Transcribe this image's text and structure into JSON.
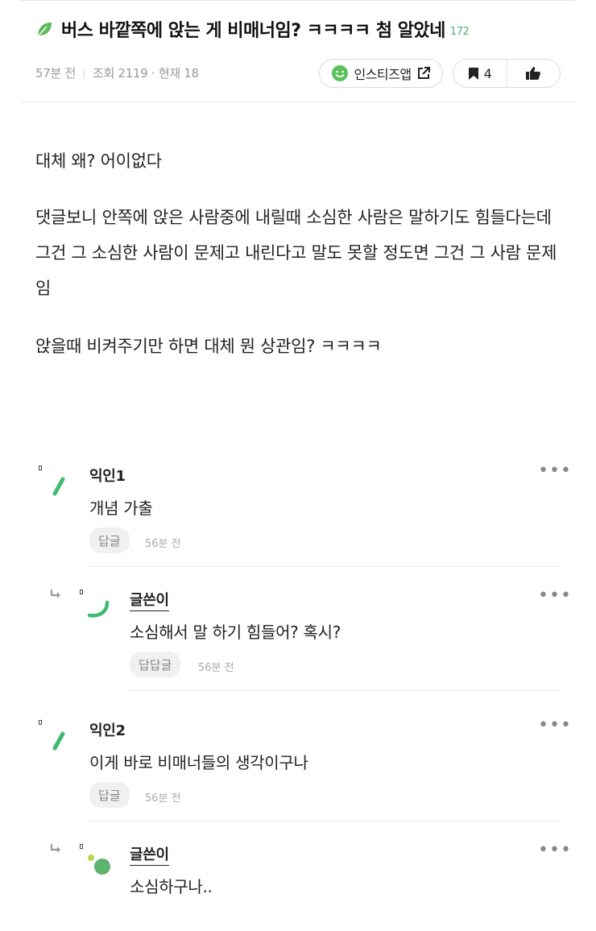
{
  "post": {
    "title": "버스 바깥쪽에 앉는 게 비매너임? ㅋㅋㅋㅋ 첨 알았네",
    "comment_count": "172",
    "meta": {
      "time_ago": "57분 전",
      "views": "조회 2119 · 현재 18"
    },
    "app_button_label": "인스티즈앱",
    "bookmark_count": "4",
    "body": [
      "대체 왜? 어이없다",
      "댓글보니 안쪽에 앉은 사람중에 내릴때 소심한 사람은 말하기도 힘들다는데 그건 그 소심한 사람이 문제고 내린다고 말도 못할 정도면 그건 그 사람 문제임",
      "앉을때 비켜주기만 하면 대체 뭔 상관임? ㅋㅋㅋㅋ"
    ]
  },
  "comments": [
    {
      "author": "익인1",
      "text": "개념 가출",
      "reply_label": "답글",
      "time": "56분 전",
      "is_reply": false
    },
    {
      "author": "글쓴이",
      "text": "소심해서 말 하기 힘들어? 혹시?",
      "reply_label": "답답글",
      "time": "56분 전",
      "is_reply": true
    },
    {
      "author": "익인2",
      "text": "이게 바로 비매너들의 생각이구나",
      "reply_label": "답글",
      "time": "56분 전",
      "is_reply": false
    },
    {
      "author": "글쓴이",
      "text": "소심하구나..",
      "is_reply": true
    }
  ],
  "icons": {
    "leaf": "leaf-icon",
    "smile": "smile-icon",
    "external": "external-link-icon",
    "bookmark": "bookmark-icon",
    "like": "thumbs-up-icon",
    "more": "more-dots-icon",
    "reply_arrow": "reply-arrow-icon"
  },
  "colors": {
    "accent_green": "#4caf6e",
    "text": "#222222",
    "muted": "#9a9a9a"
  }
}
